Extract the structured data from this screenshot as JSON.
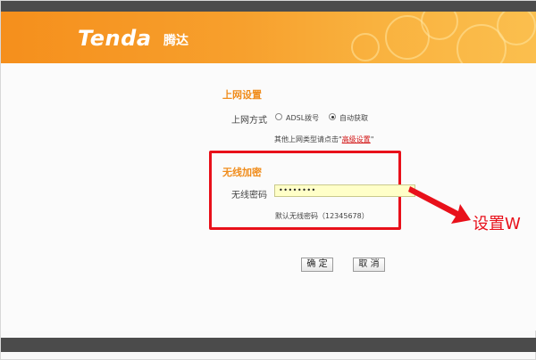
{
  "brand": {
    "logo_text": "Tenda",
    "logo_cn": "腾达",
    "header_color": "#f7a02d"
  },
  "internet": {
    "title": "上网设置",
    "mode_label": "上网方式",
    "options": [
      "ADSL拨号",
      "自动获取"
    ],
    "selected": "自动获取",
    "other_text_prefix": "其他上网类型请点击\"",
    "advanced_link": "高级设置",
    "other_text_suffix": "\""
  },
  "wireless": {
    "title": "无线加密",
    "password_label": "无线密码",
    "password_value": "••••••••",
    "default_hint": "默认无线密码（12345678）"
  },
  "buttons": {
    "ok": "确 定",
    "cancel": "取 消"
  },
  "annotation": {
    "text": "设置W",
    "color": "#e8101a"
  }
}
